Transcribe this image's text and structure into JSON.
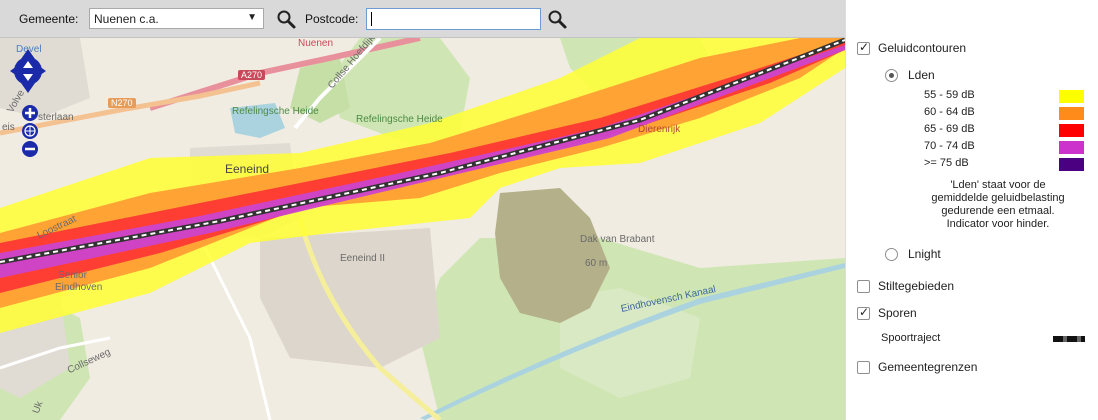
{
  "toolbar": {
    "gemeente_label": "Gemeente:",
    "gemeente_value": "Nuenen c.a.",
    "postcode_label": "Postcode:",
    "postcode_value": ""
  },
  "map": {
    "labels": {
      "devel": "Devel",
      "a270": "A270",
      "n270": "N270",
      "nuenen": "Nuenen",
      "refelingse_heide": "Refelingsche Heide",
      "refelingse_heide2": "Refelingsche Heide",
      "collse_hoefdijk": "Collse Hoefdijk",
      "dierenrijk": "Dierenrijk",
      "eeneind": "Eeneind",
      "eeneind_ii": "Eeneind II",
      "dak_van_brabant": "Dak van Brabant",
      "dak_height": "60 m",
      "eindhovensch_kanaal": "Eindhovensch Kanaal",
      "collseweg": "Collseweg",
      "loostraat": "Loostraat",
      "sterlaan": "sterlaan",
      "vol": "Volve",
      "eis": "eis",
      "senior": "Senior",
      "eindhoven": "Eindhoven",
      "uk": "Uk"
    },
    "icons": [
      "pan-north-icon",
      "pan-south-icon",
      "pan-west-icon",
      "pan-east-icon",
      "zoom-in-icon",
      "globe-icon",
      "zoom-out-icon"
    ]
  },
  "panel": {
    "geluidcontouren": {
      "label": "Geluidcontouren",
      "checked": true
    },
    "lden": {
      "label": "Lden",
      "checked": true
    },
    "legend": [
      {
        "label": "55 - 59 dB",
        "color": "#ffff00"
      },
      {
        "label": "60 - 64 dB",
        "color": "#ff8c1a"
      },
      {
        "label": "65 - 69 dB",
        "color": "#ff0000"
      },
      {
        "label": "70 - 74 dB",
        "color": "#cc33cc"
      },
      {
        "label": ">= 75 dB",
        "color": "#4b0082"
      }
    ],
    "lden_desc_1": "'Lden' staat voor de",
    "lden_desc_2": "gemiddelde geluidbelasting",
    "lden_desc_3": "gedurende een etmaal.",
    "lden_desc_4": "Indicator voor hinder.",
    "lnight": {
      "label": "Lnight",
      "checked": false
    },
    "stiltegebieden": {
      "label": "Stiltegebieden",
      "checked": false
    },
    "sporen": {
      "label": "Sporen",
      "checked": true
    },
    "spoortraject": {
      "label": "Spoortraject"
    },
    "gemeentegrenzen": {
      "label": "Gemeentegrenzen",
      "checked": false
    }
  }
}
